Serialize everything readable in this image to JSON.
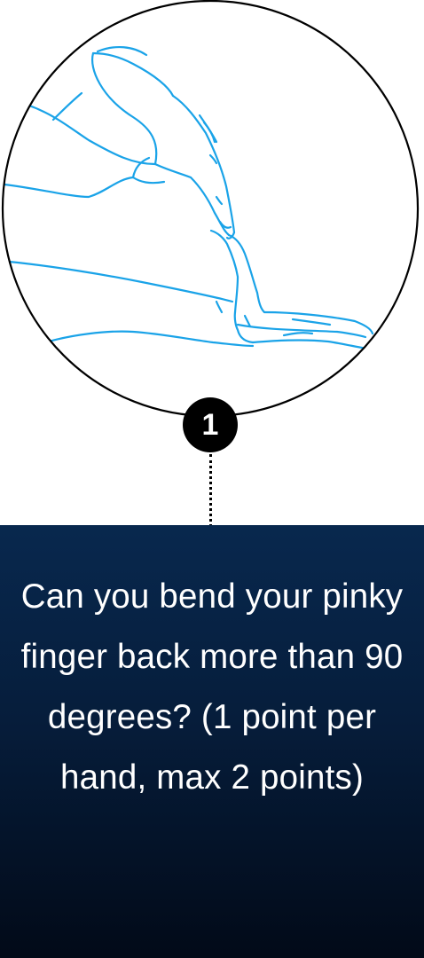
{
  "step": {
    "number": "1"
  },
  "question": {
    "text": "Can you bend your pinky finger back more than 90 degrees? (1 point per hand, max 2 points)"
  },
  "colors": {
    "illustration_stroke": "#1aa3e8",
    "circle_stroke": "#000000",
    "badge_background": "#000000",
    "panel_top": "#08284e",
    "panel_bottom": "#020a18",
    "text": "#ffffff"
  },
  "icons": {
    "illustration": "hand-pinky-bend-illustration"
  }
}
